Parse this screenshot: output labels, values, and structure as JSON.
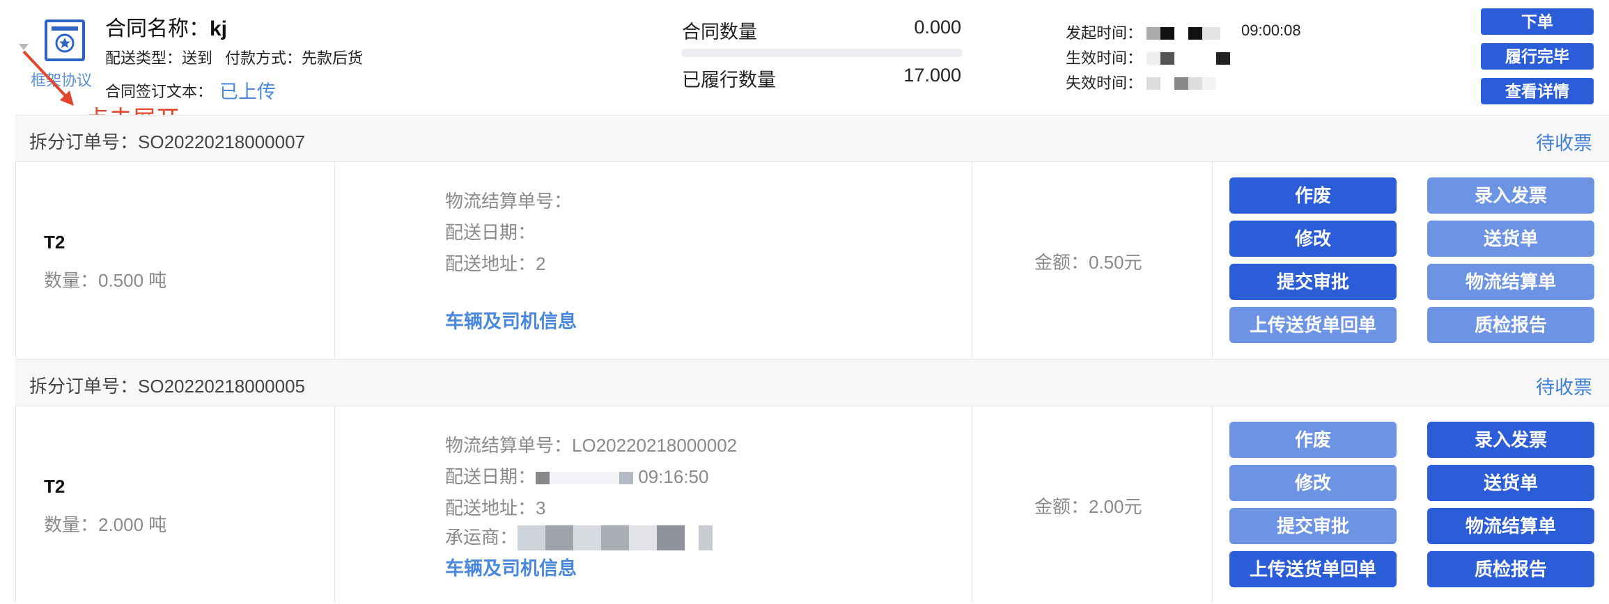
{
  "contract": {
    "name_label": "合同名称：",
    "name_value": "kj",
    "framework_link": "框架协议",
    "delivery_type_label": "配送类型：",
    "delivery_type_value": "送到",
    "payment_label": "付款方式：",
    "payment_value": "先款后货",
    "sign_text_label": "合同签订文本：",
    "sign_text_value": "已上传",
    "quantity_label": "合同数量",
    "quantity_value": "0.000",
    "fulfilled_label": "已履行数量",
    "fulfilled_value": "17.000",
    "start_time_label": "发起时间：",
    "start_time_visible": "09:00:08",
    "effective_time_label": "生效时间：",
    "expire_time_label": "失效时间：",
    "buttons": {
      "order": "下单",
      "complete": "履行完毕",
      "details": "查看详情"
    },
    "annotation": "点击展开"
  },
  "split_orders": [
    {
      "order_label": "拆分订单号：",
      "order_no": "SO20220218000007",
      "status": "待收票",
      "product": "T2",
      "quantity": "数量：0.500 吨",
      "settlement_label": "物流结算单号：",
      "settlement_no": "",
      "delivery_date_label": "配送日期：",
      "delivery_date": "",
      "address_label": "配送地址：",
      "address": "2",
      "vehicle_link": "车辆及司机信息",
      "amount": "金额：0.50元",
      "actions": {
        "void": "作废",
        "invoice": "录入发票",
        "edit": "修改",
        "delivery_note": "送货单",
        "submit": "提交审批",
        "logistics": "物流结算单",
        "upload": "上传送货单回单",
        "qc": "质检报告"
      }
    },
    {
      "order_label": "拆分订单号：",
      "order_no": "SO20220218000005",
      "status": "待收票",
      "product": "T2",
      "quantity": "数量：2.000 吨",
      "settlement_label": "物流结算单号：",
      "settlement_no": "LO20220218000002",
      "delivery_date_label": "配送日期：",
      "delivery_date": "09:16:50",
      "address_label": "配送地址：",
      "address": "3",
      "carrier_label": "承运商：",
      "vehicle_link": "车辆及司机信息",
      "amount": "金额：2.00元",
      "actions": {
        "void": "作废",
        "invoice": "录入发票",
        "edit": "修改",
        "delivery_note": "送货单",
        "submit": "提交审批",
        "logistics": "物流结算单",
        "upload": "上传送货单回单",
        "qc": "质检报告"
      }
    }
  ],
  "colors": {
    "primary": "#2c5dd8",
    "primary_light": "#6c93e4",
    "link": "#4a88de",
    "annotation": "#e2452c"
  },
  "icons": [
    "contract-icon",
    "collapse-caret-icon",
    "annotation-arrow-icon"
  ]
}
